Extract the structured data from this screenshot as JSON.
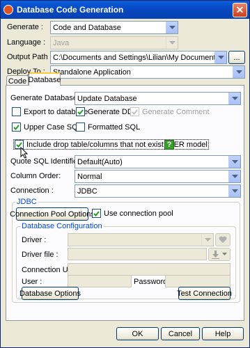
{
  "window": {
    "title": "Database Code Generation",
    "icon": "app-icon",
    "close_label": "✕"
  },
  "top": {
    "generate_label": "Generate :",
    "generate_value": "Code and Database",
    "language_label": "Language :",
    "language_value": "Java",
    "output_label": "Output Path :",
    "output_value": "C:\\Documents and Settings\\Lilian\\My Documents\\untitled",
    "browse_label": "...",
    "deploy_label": "Deploy To :",
    "deploy_value": "Standalone Application"
  },
  "tabs": [
    {
      "label": "Code"
    },
    {
      "label": "Database"
    }
  ],
  "database": {
    "generate_db_label": "Generate Database :",
    "generate_db_value": "Update Database",
    "export_label": "Export to database",
    "export_checked": false,
    "ddl_label": "Generate DDL",
    "ddl_checked": true,
    "comment_label": "Generate Comment",
    "comment_checked": true,
    "uppercase_label": "Upper Case SQL",
    "uppercase_checked": true,
    "formatted_label": "Formatted SQL",
    "formatted_checked": false,
    "include_drop_label": "Include drop table/columns that not exist in ER model",
    "include_drop_checked": true,
    "help_label": "?",
    "quote_label": "Quote SQL Identifier:",
    "quote_value": "Default(Auto)",
    "column_order_label": "Column Order:",
    "column_order_value": "Normal",
    "connection_label": "Connection :",
    "connection_value": "JDBC"
  },
  "jdbc": {
    "title": "JDBC",
    "pool_button": "Connection Pool Options",
    "use_pool_label": "Use connection pool",
    "use_pool_checked": true,
    "config_title": "Database Configuration",
    "driver_label": "Driver :",
    "driver_file_label": "Driver file :",
    "url_label": "Connection URL :",
    "user_label": "User :",
    "password_label": "Password :",
    "db_options_button": "Database Options",
    "test_button": "Test Connection"
  },
  "footer": {
    "ok": "OK",
    "cancel": "Cancel",
    "help": "Help"
  },
  "colors": {
    "accent": "#0a5fdc",
    "help_green": "#3aa02a",
    "group_title": "#0046d5"
  }
}
